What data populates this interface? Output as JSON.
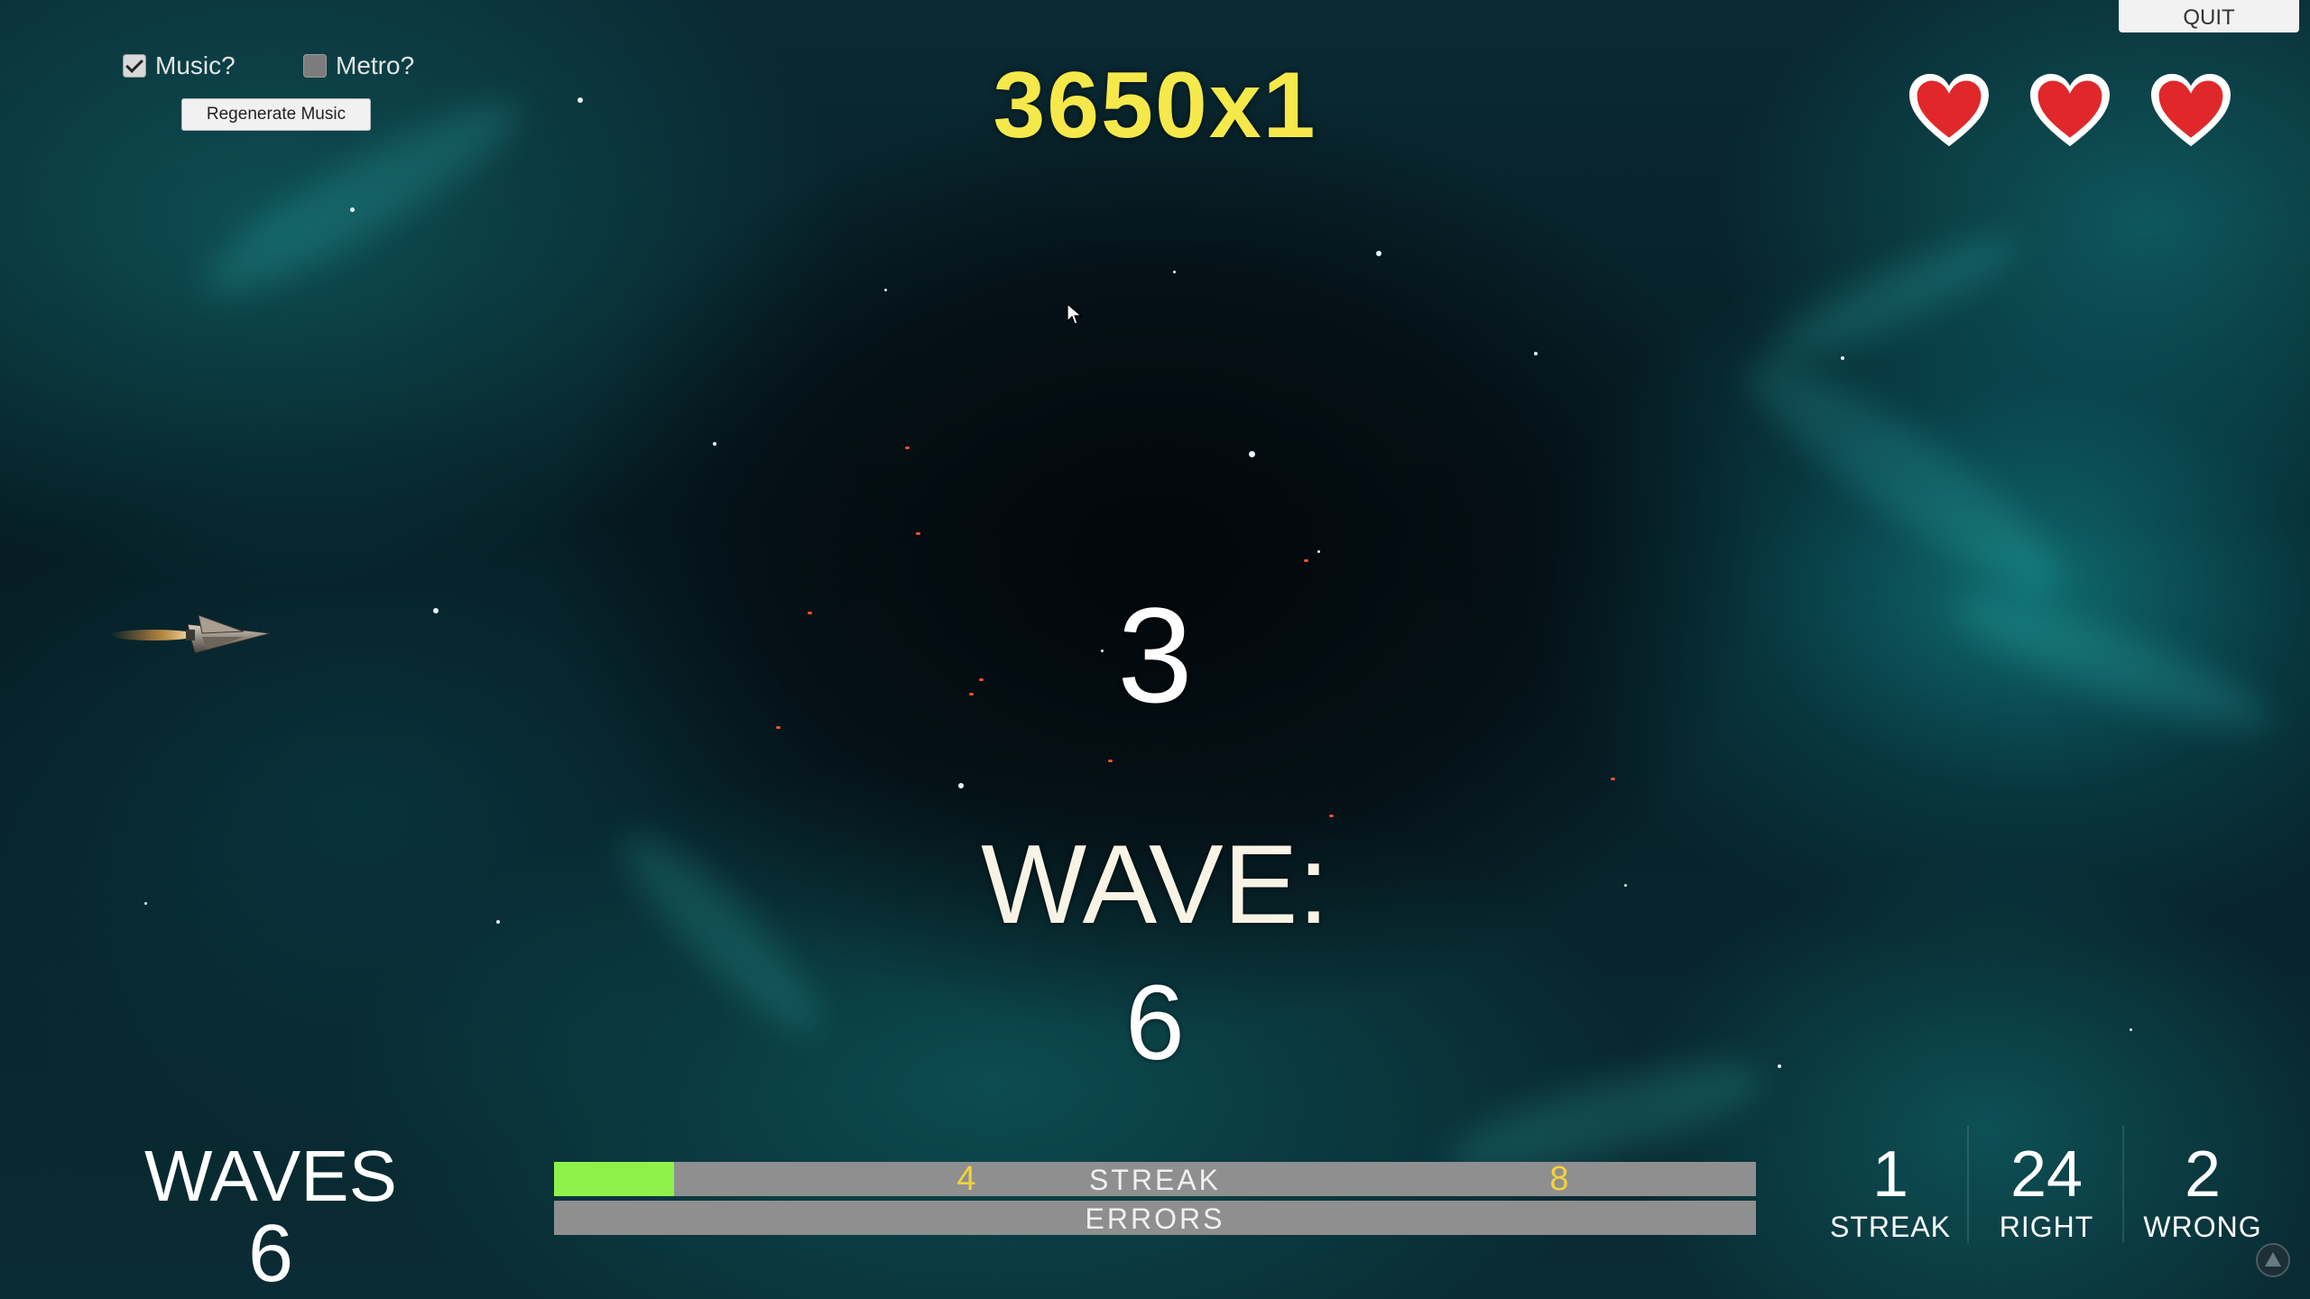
{
  "hud": {
    "music_toggle": {
      "label": "Music?",
      "checked": true
    },
    "metro_toggle": {
      "label": "Metro?",
      "checked": false
    },
    "regenerate_label": "Regenerate Music",
    "quit_label": "QUIT",
    "score": "3650x1",
    "lives": 3,
    "heart_color": "#e0282a"
  },
  "center": {
    "countdown": "3",
    "wave_label": "WAVE:",
    "wave_number": "6"
  },
  "bottom": {
    "waves_label": "WAVES",
    "waves_value": "6",
    "streak_bar": {
      "label": "STREAK",
      "fill_fraction": 0.1,
      "fill_color": "#8ef24a",
      "markers": [
        "4",
        "8"
      ]
    },
    "errors_bar": {
      "label": "ERRORS"
    },
    "stats": [
      {
        "value": "1",
        "label": "STREAK"
      },
      {
        "value": "24",
        "label": "RIGHT"
      },
      {
        "value": "2",
        "label": "WRONG"
      }
    ]
  },
  "icons": {
    "ship": "spaceship-icon",
    "heart": "heart-icon",
    "cursor": "mouse-cursor-icon",
    "corner": "watermark-icon"
  }
}
